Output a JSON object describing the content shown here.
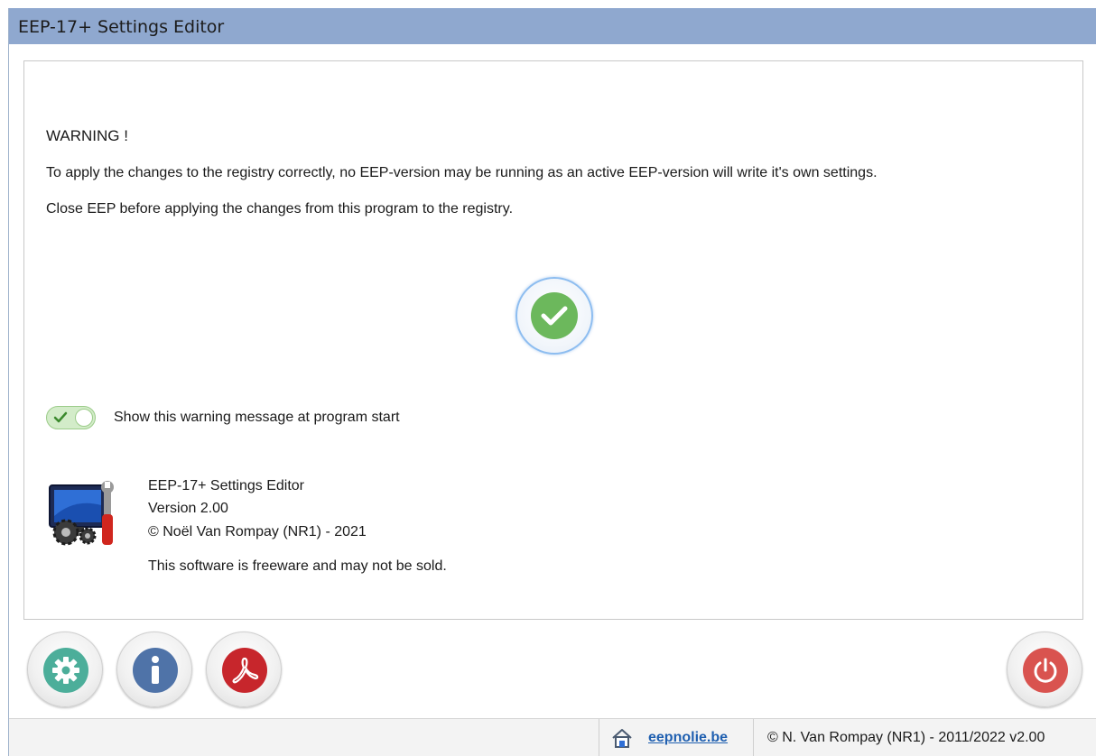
{
  "window": {
    "title": "EEP-17+ Settings Editor"
  },
  "warning": {
    "title": "WARNING !",
    "line1": "To apply the changes to the registry correctly, no EEP-version may be running as an active EEP-version will write it's own settings.",
    "line2": "Close EEP before applying the changes from this program to the registry.",
    "confirm_icon": "checkmark-icon"
  },
  "toggle": {
    "label": "Show this warning message at program start",
    "checked": true
  },
  "about": {
    "name": "EEP-17+ Settings Editor",
    "version": "Version 2.00",
    "copyright": "© Noël Van Rompay (NR1) - 2021",
    "license": "This software is freeware and may not be sold."
  },
  "toolbar": {
    "settings_icon": "gear-icon",
    "info_icon": "info-icon",
    "pdf_icon": "pdf-icon",
    "power_icon": "power-icon"
  },
  "statusbar": {
    "link": "eepnolie.be",
    "copyright": "© N. Van Rompay (NR1) - 2011/2022 v2.00"
  },
  "colors": {
    "titlebar": "#8fa8cf",
    "confirm": "#6cb85c",
    "settings": "#4cae9a",
    "info": "#4f73a8",
    "pdf": "#c7262c",
    "power": "#d9534f",
    "link": "#1f5fb0"
  }
}
